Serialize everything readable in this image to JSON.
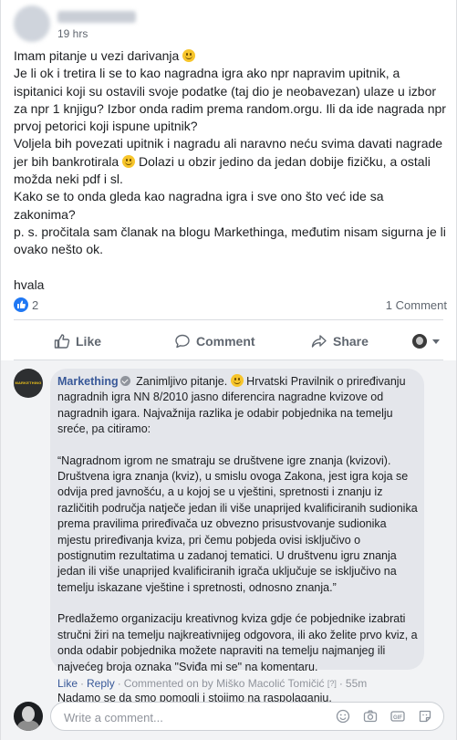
{
  "post": {
    "time": "19 hrs",
    "paragraphs": [
      [
        "Imam pitanje u vezi darivanja "
      ],
      [
        "Je li ok i tretira li se to kao nagradna igra ako npr napravim upitnik, a ispitanici koji su ostavili svoje podatke (taj dio je neobavezan) ulaze u izbor za npr 1 knjigu? Izbor onda radim prema random.orgu. Ili da ide nagrada npr prvoj petorici koji ispune upitnik?"
      ],
      [
        "Voljela bih povezati upitnik i nagradu ali naravno neću svima davati nagrade jer bih bankrotirala ",
        " Dolazi u obzir jedino da jedan dobije fizičku, a ostali možda neki pdf i sl."
      ],
      [
        "Kako se to onda gleda kao nagradna igra i sve ono što već ide sa zakonima?"
      ],
      [
        "p. s. pročitala sam članak na blogu Markethinga, međutim nisam sigurna je li ovako nešto ok."
      ],
      [
        "hvala"
      ]
    ],
    "reaction_count": "2",
    "comment_count": "1 Comment"
  },
  "actions": {
    "like": "Like",
    "comment": "Comment",
    "share": "Share"
  },
  "comment": {
    "author": "Markething",
    "avatar_text": "MARKETHING",
    "intro": " Zanimljivo pitanje. ",
    "intro_rest": " Hrvatski Pravilnik o priređivanju nagradnih igra NN 8/2010 jasno diferencira nagradne kvizove od nagradnih igara. Najvažnija razlika je odabir pobjednika na temelju sreće, pa citiramo:",
    "quote": "“Nagradnom igrom ne smatraju se društvene igre znanja (kvizovi). Društvena igra znanja (kviz), u smislu ovoga Zakona, jest igra koja se odvija pred javnošću, a u kojoj se u vještini, spretnosti i znanju iz različitih područja natječe jedan ili više unaprijed kvalificiranih sudionika prema pravilima priređivača uz obvezno prisustvovanje sudionika mjestu priređivanja kviza, pri čemu pobjeda ovisi isključivo o postignutim rezultatima u zadanoj tematici. U društvenu igru znanja jedan ili više unaprijed kvalificiranih igrača uključuje se isključivo na temelju iskazane vještine i spretnosti, odnosno znanja.”",
    "suggestion": "Predlažemo organizaciju kreativnog kviza gdje će pobjednike izabrati stručni žiri na temelju najkreativnijeg odgovora, ili ako želite prvo kviz, a onda odabir pobjednika možete napraviti na temelju najmanjeg ili najvećeg broja oznaka \"Sviđa mi se\" na komentaru.",
    "closing": "Nadamo se da smo pomogli i stojimo na raspolaganju.",
    "meta": {
      "like": "Like",
      "reply": "Reply",
      "commented_on": "Commented on by Miško Macolić Tomičić",
      "q_mark": "[?]",
      "time": "55m"
    }
  },
  "composer": {
    "placeholder": "Write a comment..."
  }
}
